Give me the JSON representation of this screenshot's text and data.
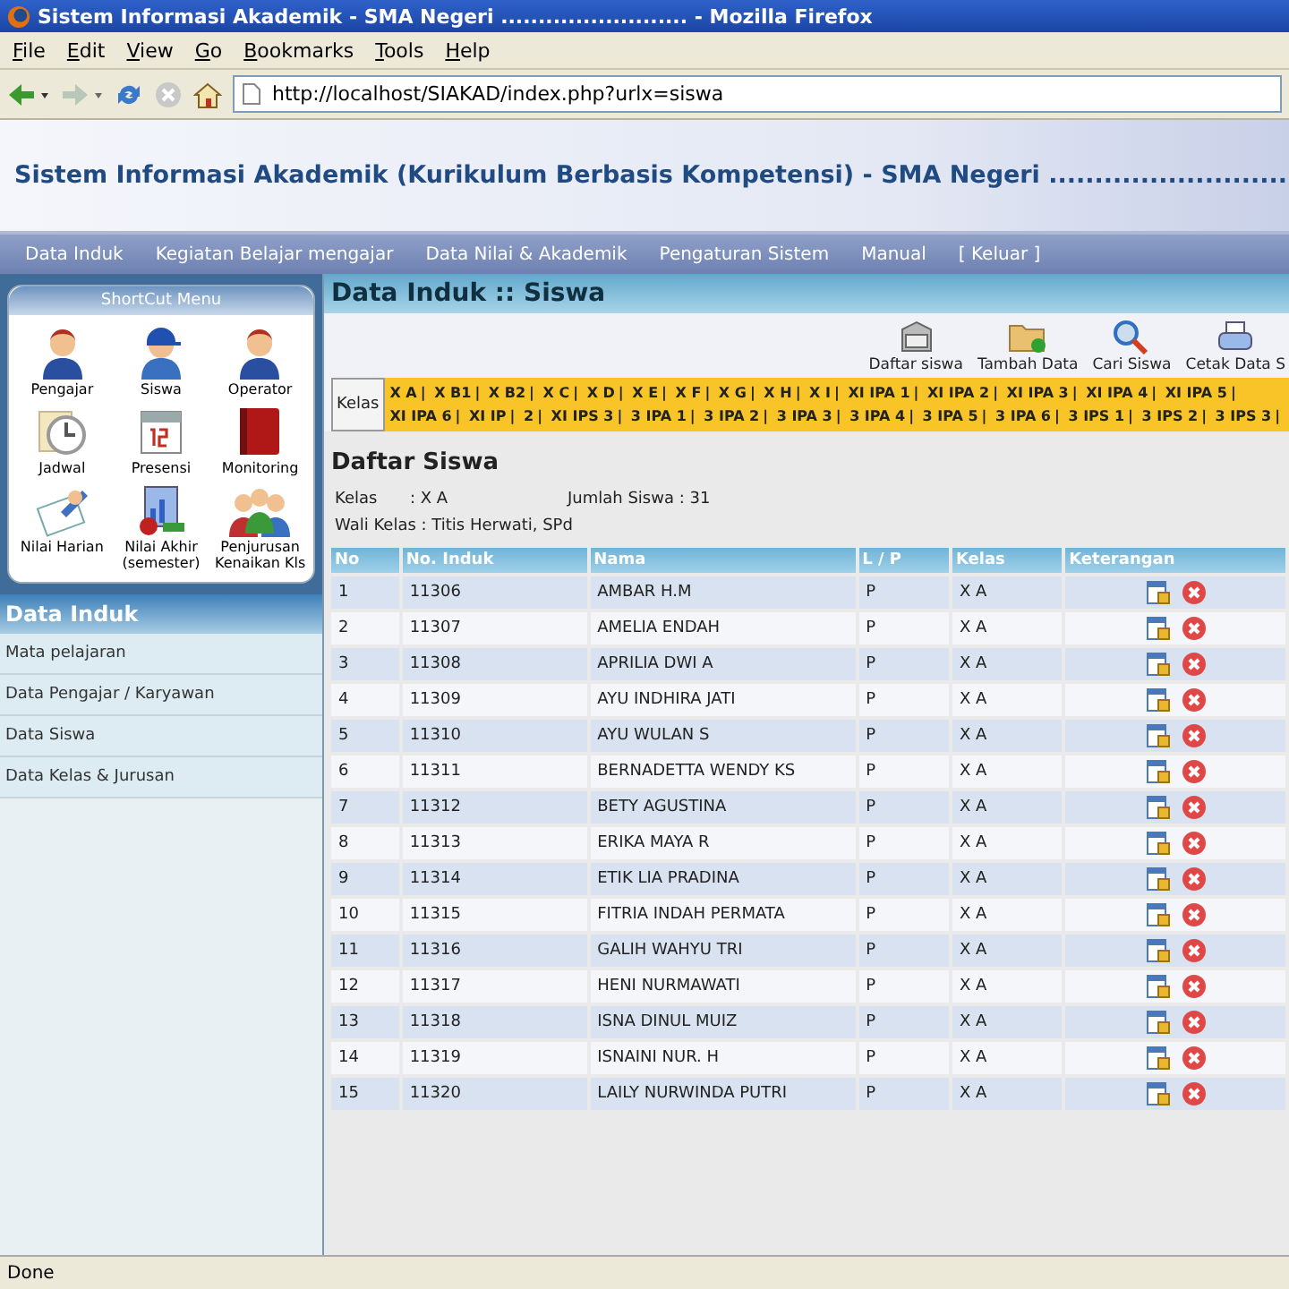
{
  "window": {
    "title": "Sistem Informasi Akademik - SMA Negeri ......................... - Mozilla Firefox"
  },
  "menu_bar": [
    "File",
    "Edit",
    "View",
    "Go",
    "Bookmarks",
    "Tools",
    "Help"
  ],
  "address_bar": {
    "value": "http://localhost/SIAKAD/index.php?urlx=siswa"
  },
  "site_header": {
    "title": "Sistem Informasi Akademik (Kurikulum Berbasis Kompetensi) - SMA Negeri ..........................."
  },
  "nav_menu": [
    "Data Induk",
    "Kegiatan Belajar mengajar",
    "Data Nilai & Akademik",
    "Pengaturan Sistem",
    "Manual",
    "[ Keluar ]"
  ],
  "shortcut_menu": {
    "title": "ShortCut Menu",
    "items": [
      {
        "label": "Pengajar",
        "kind": "person"
      },
      {
        "label": "Siswa",
        "kind": "student"
      },
      {
        "label": "Operator",
        "kind": "person"
      },
      {
        "label": "Jadwal",
        "kind": "clock"
      },
      {
        "label": "Presensi",
        "kind": "calendar"
      },
      {
        "label": "Monitoring",
        "kind": "book"
      },
      {
        "label": "Nilai Harian",
        "kind": "notepad"
      },
      {
        "label": "Nilai Akhir (semester)",
        "kind": "chart"
      },
      {
        "label": "Penjurusan Kenaikan Kls",
        "kind": "group"
      }
    ]
  },
  "sidebar": {
    "title": "Data Induk",
    "items": [
      "Mata pelajaran",
      "Data Pengajar / Karyawan",
      "Data Siswa",
      "Data Kelas & Jurusan"
    ]
  },
  "content": {
    "title": "Data Induk :: Siswa",
    "toolbar": [
      {
        "label": "Daftar siswa",
        "kind": "cabinet"
      },
      {
        "label": "Tambah Data",
        "kind": "folder"
      },
      {
        "label": "Cari Siswa",
        "kind": "search"
      },
      {
        "label": "Cetak Data S",
        "kind": "printer"
      }
    ],
    "class_filter": {
      "label": "Kelas",
      "separator": "|",
      "items": [
        "X A",
        "X B1",
        "X B2",
        "X C",
        "X D",
        "X E",
        "X F",
        "X G",
        "X H",
        "X I",
        "XI IPA 1",
        "XI IPA 2",
        "XI IPA 3",
        "XI IPA 4",
        "XI IPA 5",
        "XI IPA 6",
        "XI IP",
        "2",
        "XI IPS 3",
        "3 IPA 1",
        "3 IPA 2",
        "3 IPA 3",
        "3 IPA 4",
        "3 IPA 5",
        "3 IPA 6",
        "3 IPS 1",
        "3 IPS 2",
        "3 IPS 3"
      ]
    },
    "section_title": "Daftar Siswa",
    "info": {
      "kelas_label": "Kelas",
      "kelas_value": ": X A",
      "jumlah": "Jumlah Siswa : 31",
      "wali": "Wali Kelas : Titis Herwati, SPd"
    },
    "table": {
      "columns": [
        "No",
        "No. Induk",
        "Nama",
        "L / P",
        "Kelas",
        "Keterangan"
      ],
      "rows": [
        [
          "1",
          "11306",
          "AMBAR H.M",
          "P",
          "X A"
        ],
        [
          "2",
          "11307",
          "AMELIA ENDAH",
          "P",
          "X A"
        ],
        [
          "3",
          "11308",
          "APRILIA DWI A",
          "P",
          "X A"
        ],
        [
          "4",
          "11309",
          "AYU INDHIRA JATI",
          "P",
          "X A"
        ],
        [
          "5",
          "11310",
          "AYU WULAN S",
          "P",
          "X A"
        ],
        [
          "6",
          "11311",
          "BERNADETTA WENDY KS",
          "P",
          "X A"
        ],
        [
          "7",
          "11312",
          "BETY AGUSTINA",
          "P",
          "X A"
        ],
        [
          "8",
          "11313",
          "ERIKA MAYA R",
          "P",
          "X A"
        ],
        [
          "9",
          "11314",
          "ETIK LIA PRADINA",
          "P",
          "X A"
        ],
        [
          "10",
          "11315",
          "FITRIA INDAH PERMATA",
          "P",
          "X A"
        ],
        [
          "11",
          "11316",
          "GALIH WAHYU TRI",
          "P",
          "X A"
        ],
        [
          "12",
          "11317",
          "HENI NURMAWATI",
          "P",
          "X A"
        ],
        [
          "13",
          "11318",
          "ISNA DINUL MUIZ",
          "P",
          "X A"
        ],
        [
          "14",
          "11319",
          "ISNAINI NUR. H",
          "P",
          "X A"
        ],
        [
          "15",
          "11320",
          "LAILY NURWINDA PUTRI",
          "P",
          "X A"
        ]
      ]
    }
  },
  "status_bar": "Done"
}
